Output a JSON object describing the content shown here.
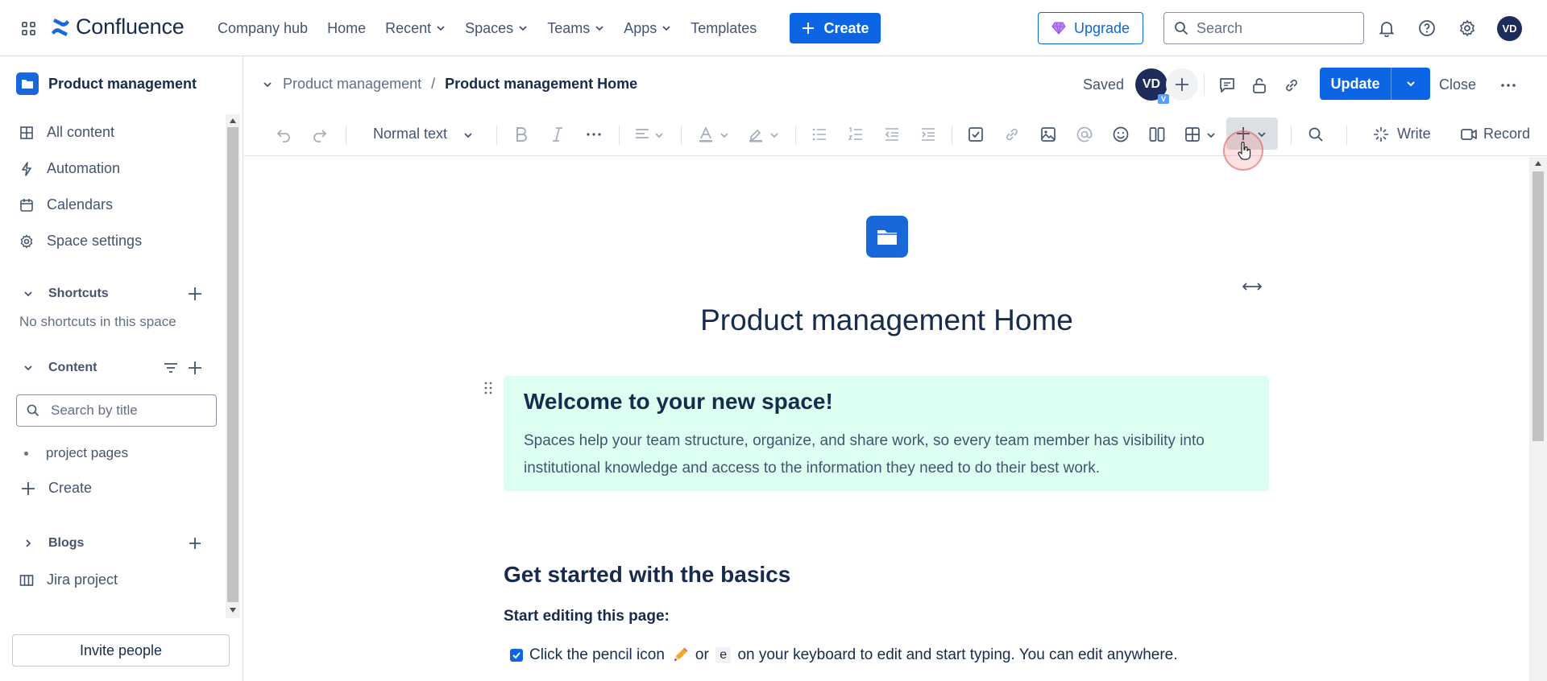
{
  "topnav": {
    "logo_text": "Confluence",
    "links": [
      {
        "label": "Company hub",
        "dropdown": false
      },
      {
        "label": "Home",
        "dropdown": false
      },
      {
        "label": "Recent",
        "dropdown": true
      },
      {
        "label": "Spaces",
        "dropdown": true
      },
      {
        "label": "Teams",
        "dropdown": true
      },
      {
        "label": "Apps",
        "dropdown": true
      },
      {
        "label": "Templates",
        "dropdown": false
      }
    ],
    "create_label": "Create",
    "upgrade_label": "Upgrade",
    "search_placeholder": "Search",
    "user_initials": "VD",
    "icons": [
      "apps-grid-icon",
      "bell-icon",
      "help-icon",
      "settings-icon"
    ]
  },
  "sidebar": {
    "space_name": "Product management",
    "items": [
      {
        "label": "All content",
        "icon": "grid-icon"
      },
      {
        "label": "Automation",
        "icon": "lightning-icon"
      },
      {
        "label": "Calendars",
        "icon": "calendar-icon"
      },
      {
        "label": "Space settings",
        "icon": "gear-icon"
      }
    ],
    "shortcuts": {
      "title": "Shortcuts",
      "empty_text": "No shortcuts in this space"
    },
    "content": {
      "title": "Content",
      "search_placeholder": "Search by title",
      "tree": [
        "project pages"
      ],
      "create_label": "Create"
    },
    "blogs": {
      "title": "Blogs"
    },
    "jira": {
      "label": "Jira project"
    },
    "invite_label": "Invite people"
  },
  "pagehead": {
    "breadcrumb_parent": "Product management",
    "breadcrumb_separator": "/",
    "breadcrumb_current": "Product management Home",
    "status": "Saved",
    "collaborator_initials": "VD",
    "collaborator_badge": "V",
    "update_label": "Update",
    "close_label": "Close"
  },
  "toolbar": {
    "text_style": "Normal text",
    "write_label": "Write",
    "record_label": "Record"
  },
  "editor": {
    "title": "Product management Home",
    "panel": {
      "heading": "Welcome to your new space!",
      "body": "Spaces help your team structure, organize, and share work, so every team member has visibility into institutional knowledge and access to the information they need to do their best work."
    },
    "section_heading": "Get started with the basics",
    "subheading": "Start editing this page:",
    "task": {
      "checked": true,
      "text_before": "Click the pencil icon",
      "text_or": "or",
      "key": "e",
      "text_after": "on your keyboard to edit and start typing. You can edit anywhere."
    }
  },
  "colors": {
    "brand_blue": "#0c66e4",
    "panel_green": "#dcfff1",
    "avatar_navy": "#1d2d5b"
  }
}
